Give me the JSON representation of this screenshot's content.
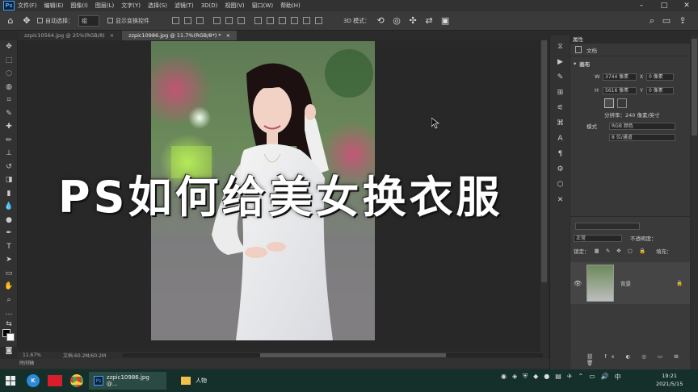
{
  "menubar": {
    "logo": "Ps",
    "items": [
      "文件(F)",
      "编辑(E)",
      "图像(I)",
      "图层(L)",
      "文字(Y)",
      "选择(S)",
      "滤镜(T)",
      "3D(D)",
      "视图(V)",
      "窗口(W)",
      "帮助(H)"
    ]
  },
  "options": {
    "auto_select_label": "自动选择：",
    "auto_select_value": "组",
    "show_transform_label": "显示变换控件",
    "mode_3d_label": "3D 模式："
  },
  "tabs": [
    {
      "label": "zzpic10564.jpg @ 25%(RGB/8)",
      "close": "×"
    },
    {
      "label": "zzpic10986.jpg @ 11.7%(RGB/8*) *",
      "close": "×"
    }
  ],
  "overlay": {
    "title": "PS如何给美女换衣服"
  },
  "status": {
    "zoom": "11.67%",
    "doc": "文档:60.2M/60.2M"
  },
  "timeline": {
    "label": "时间轴"
  },
  "properties": {
    "tab_label": "属性",
    "doc_label": "文档",
    "canvas_label": "画布",
    "w_label": "W",
    "w_value": "3744 像素",
    "h_label": "H",
    "h_value": "5616 像素",
    "x_label": "X",
    "x_value": "0 像素",
    "y_label": "Y",
    "y_value": "0 像素",
    "resolution": "分辨率：240 像素/英寸",
    "mode_label": "模式",
    "mode_value": "RGB 颜色",
    "depth_value": "8 位/通道"
  },
  "layers": {
    "blend_mode": "正常",
    "opacity_label": "不透明度：",
    "lock_label": "锁定：",
    "fill_label": "填充：",
    "layer_name": "背景"
  },
  "taskbar": {
    "ps_app_label": "zzpic10986.jpg @...",
    "folder_label": "人物",
    "clock_time": "19:21",
    "clock_date": "2021/5/15"
  },
  "colors": {
    "ps_bg": "#2b2b2b",
    "panel_bg": "#383838",
    "accent_blue": "#3ea6ff",
    "taskbar_bg": "#15302b"
  }
}
